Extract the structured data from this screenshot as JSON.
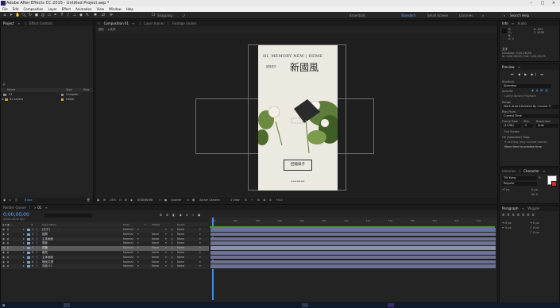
{
  "app": {
    "title": "Adobe After Effects CC 2015 - Untitled Project.aep *"
  },
  "menu": [
    "File",
    "Edit",
    "Composition",
    "Layer",
    "Effect",
    "Animation",
    "View",
    "Window",
    "Help"
  ],
  "toolbar": {
    "snapping_label": "Snapping",
    "workspaces": [
      "Essentials",
      "Standard",
      "Small Screen",
      "Libraries"
    ],
    "active_workspace": "Standard",
    "search_placeholder": "Search Help"
  },
  "project": {
    "tabs": [
      "Project",
      "Effect Controls"
    ],
    "search_placeholder": "ρ",
    "columns": [
      "Name",
      "Type",
      "Size"
    ],
    "items": [
      {
        "name": "01",
        "type": "Composi...",
        "size": ""
      },
      {
        "name": "01 Layers",
        "type": "Folder",
        "size": ""
      }
    ],
    "footer_bpc": "8 bpc"
  },
  "composition": {
    "tabs": [
      "Composition",
      "01",
      "Layer (none)",
      "Footage (none)"
    ],
    "breadcrumb": "01",
    "sub": "文字",
    "zoom": "25%",
    "timecode": "0;00;00;00",
    "resolution": "Quarter",
    "camera": "Active Camera",
    "view": "1 View",
    "offset": "+0.0"
  },
  "artwork": {
    "english_title": "HI, MEMORY NEW | HEME",
    "chinese_title": "新國風",
    "chinese_small": "回憶錄子",
    "stamp": "回憶錄子"
  },
  "info": {
    "tabs": [
      "Info",
      "Audio"
    ],
    "rgb": [
      {
        "k": "R:",
        "v": ""
      },
      {
        "k": "G:",
        "v": ""
      },
      {
        "k": "B:",
        "v": ""
      },
      {
        "k": "A:",
        "v": "0"
      }
    ],
    "xy": [
      {
        "k": "X:",
        "v": "404"
      },
      {
        "k": "Y:",
        "v": "1038"
      }
    ],
    "layer_name": "文字",
    "details": [
      "Duration: 0;00;26;06",
      "In: 0;00;00;00, Out: 0;00;25;29"
    ]
  },
  "preview": {
    "title": "Preview",
    "shortcut_label": "Shortcut",
    "shortcut_value": "Spacebar",
    "include_label": "Include:",
    "cache_label": "Cache Before Playback",
    "range_label": "Range",
    "range_value": "Work Area Extended By Current Ti",
    "play_from_label": "Play From",
    "play_from_value": "Current Time",
    "frame_rate_label": "Frame Rate",
    "skip_label": "Skip",
    "resolution_label": "Resolution",
    "frame_rate_value": "(23.98)",
    "skip_value": "0",
    "resolution_value": "Auto",
    "full_screen_label": "Full Screen",
    "on_stop_label": "On (Spacebar) Stop:",
    "if_caching_label": "If caching, play cached frames",
    "move_time_label": "Move time to preview time"
  },
  "character": {
    "tabs": [
      "Libraries",
      "Character"
    ],
    "font": "TW Kang",
    "style": "Regular",
    "size": "px",
    "leading": "px",
    "tracking": "0"
  },
  "paragraph": {
    "tabs": [
      "Paragraph",
      "Wiggler"
    ],
    "values": [
      "0 px",
      "0 px",
      "0 px",
      "0 px",
      "0 px"
    ]
  },
  "timeline": {
    "tabs": [
      "Render Queue",
      "01"
    ],
    "timecode": "0;00;00;00",
    "frame_info": "00000 (29.97 fps)",
    "columns": [
      "#",
      "Layer Name",
      "Mode",
      "T",
      "TrkMat",
      "Parent"
    ],
    "layers": [
      {
        "num": "1",
        "name": "[文字]",
        "mode": "Normal",
        "trkmat": "",
        "parent": "None"
      },
      {
        "num": "2",
        "name": "圖層",
        "mode": "Normal",
        "trkmat": "None",
        "parent": "None"
      },
      {
        "num": "3",
        "name": "主体画面",
        "mode": "Normal",
        "trkmat": "None",
        "parent": "None"
      },
      {
        "num": "4",
        "name": "頭部",
        "mode": "Normal",
        "trkmat": "None",
        "parent": "None"
      },
      {
        "num": "5",
        "name": "花板",
        "mode": "Normal",
        "trkmat": "None",
        "parent": "None"
      },
      {
        "num": "6",
        "name": "圖层",
        "mode": "Normal",
        "trkmat": "None",
        "parent": "None"
      },
      {
        "num": "7",
        "name": "主体画面",
        "mode": "Normal",
        "trkmat": "None",
        "parent": "None"
      },
      {
        "num": "8",
        "name": "瑰画文理",
        "mode": "Normal",
        "trkmat": "None",
        "parent": "None"
      },
      {
        "num": "9",
        "name": "背板 01",
        "mode": "Normal",
        "trkmat": "None",
        "parent": "None"
      }
    ],
    "ruler": [
      "00s",
      "02s",
      "04s",
      "06s",
      "08s",
      "10s",
      "12s",
      "14s",
      "16s",
      "18s",
      "20s",
      "22s",
      "24s"
    ],
    "toggle_label": "Toggle Switches / Modes"
  }
}
